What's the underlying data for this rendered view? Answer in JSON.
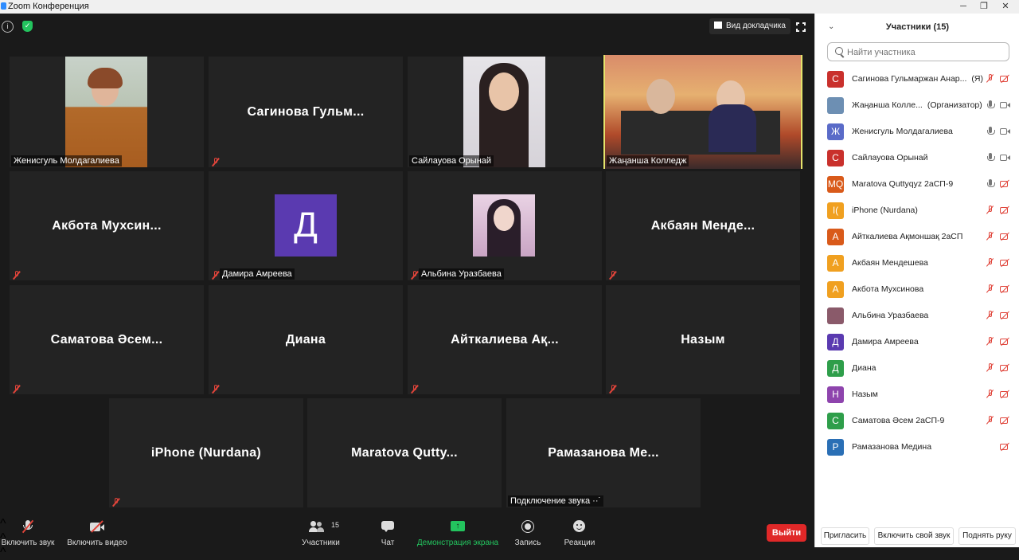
{
  "window": {
    "title": "Zoom Конференция"
  },
  "meeting": {
    "speaker_view_label": "Вид докладчика",
    "tiles": [
      {
        "label": "Женисгуль Молдагалиева",
        "muted": false,
        "kind": "video"
      },
      {
        "title": "Сагинова  Гульм...",
        "muted": true,
        "kind": "name"
      },
      {
        "label": "Сайлауова Орынай",
        "muted": false,
        "kind": "video"
      },
      {
        "label": "Жаңанша Колледж",
        "muted": false,
        "kind": "video",
        "active": true
      },
      {
        "title": "Акбота  Мухсин...",
        "muted": true,
        "kind": "name"
      },
      {
        "label": "Дамира Амреева",
        "muted": true,
        "kind": "letter",
        "letter": "Д",
        "color": "#5a3ab0"
      },
      {
        "label": "Альбина Уразбаева",
        "muted": true,
        "kind": "photo"
      },
      {
        "title": "Акбаян  Менде...",
        "muted": true,
        "kind": "name"
      },
      {
        "title": "Саматова  Әсем...",
        "muted": true,
        "kind": "name"
      },
      {
        "title": "Диана",
        "muted": true,
        "kind": "name"
      },
      {
        "title": "Айткалиева  Ақ...",
        "muted": true,
        "kind": "name"
      },
      {
        "title": "Назым",
        "muted": true,
        "kind": "name"
      },
      {
        "title": "iPhone (Nurdana)",
        "muted": true,
        "kind": "name"
      },
      {
        "title": "Maratova  Qutty...",
        "muted": false,
        "kind": "name"
      },
      {
        "title": "Рамазанова  Ме...",
        "muted": false,
        "kind": "name",
        "label": "Подключение звука ··˙"
      }
    ]
  },
  "toolbar": {
    "unmute_label": "Включить звук",
    "start_video_label": "Включить видео",
    "participants_label": "Участники",
    "participants_count": "15",
    "chat_label": "Чат",
    "share_label": "Демонстрация экрана",
    "record_label": "Запись",
    "reactions_label": "Реакции",
    "end_label": "Выйти",
    "share_color": "#23c45e",
    "end_color": "#e02828"
  },
  "panel": {
    "title": "Участники (15)",
    "search_placeholder": "Найти участника",
    "participants": [
      {
        "initial": "С",
        "color": "#c9302c",
        "name": "Сагинова Гульмаржан Анар...",
        "tag": "(Я)",
        "mic": "off",
        "cam": "off"
      },
      {
        "initial": "",
        "color": "#6d8fb3",
        "name": "Жаңанша Колле...",
        "tag": "(Организатор)",
        "mic": "on",
        "cam": "on"
      },
      {
        "initial": "Ж",
        "color": "#5a6bc8",
        "name": "Женисгуль Молдагалиева",
        "tag": "",
        "mic": "on",
        "cam": "on"
      },
      {
        "initial": "С",
        "color": "#c9302c",
        "name": "Сайлауова Орынай",
        "tag": "",
        "mic": "on",
        "cam": "on"
      },
      {
        "initial": "MQ",
        "color": "#d95a1a",
        "name": "Maratova Quttyqyz 2аСП-9",
        "tag": "",
        "mic": "on",
        "cam": "off"
      },
      {
        "initial": "I(",
        "color": "#f0a020",
        "name": "iPhone (Nurdana)",
        "tag": "",
        "mic": "off",
        "cam": "off"
      },
      {
        "initial": "А",
        "color": "#d95a1a",
        "name": "Айткалиева Ақмоншақ 2аСП",
        "tag": "",
        "mic": "off",
        "cam": "off"
      },
      {
        "initial": "А",
        "color": "#f0a020",
        "name": "Акбаян Мендешева",
        "tag": "",
        "mic": "off",
        "cam": "off"
      },
      {
        "initial": "А",
        "color": "#f0a020",
        "name": "Акбота Мухсинова",
        "tag": "",
        "mic": "off",
        "cam": "off"
      },
      {
        "initial": "",
        "color": "#8a5a6a",
        "name": "Альбина Уразбаева",
        "tag": "",
        "mic": "off",
        "cam": "off"
      },
      {
        "initial": "Д",
        "color": "#5a3ab0",
        "name": "Дамира Амреева",
        "tag": "",
        "mic": "off",
        "cam": "off"
      },
      {
        "initial": "Д",
        "color": "#2e9e4a",
        "name": "Диана",
        "tag": "",
        "mic": "off",
        "cam": "off"
      },
      {
        "initial": "Н",
        "color": "#8e44ad",
        "name": "Назым",
        "tag": "",
        "mic": "off",
        "cam": "off"
      },
      {
        "initial": "С",
        "color": "#2e9e4a",
        "name": "Саматова Әсем 2аСП-9",
        "tag": "",
        "mic": "off",
        "cam": "off"
      },
      {
        "initial": "Р",
        "color": "#2a6fb5",
        "name": "Рамазанова Медина",
        "tag": "",
        "mic": "none",
        "cam": "off"
      }
    ],
    "invite_label": "Пригласить",
    "unmute_me_label": "Включить свой звук",
    "raise_hand_label": "Поднять руку"
  }
}
